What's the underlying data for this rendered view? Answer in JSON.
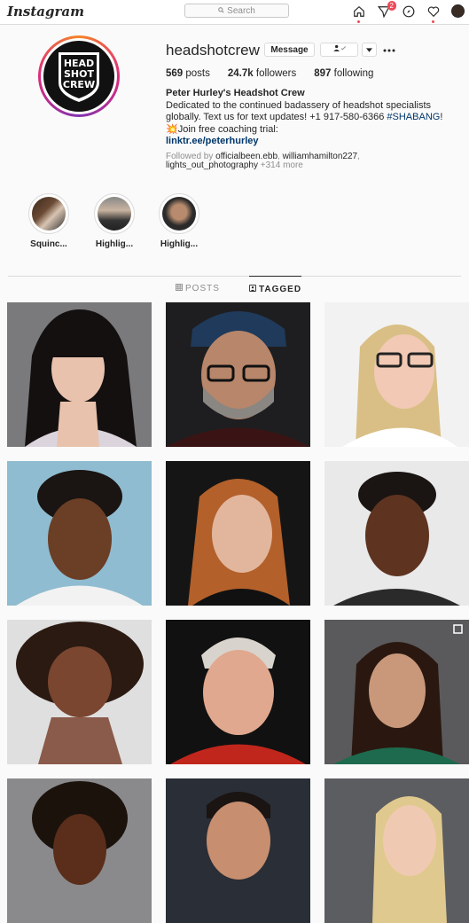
{
  "topbar": {
    "logo": "Instagram",
    "search_placeholder": "Search",
    "activity_badge": "2",
    "icons": [
      "home-icon",
      "direct-icon",
      "explore-icon",
      "heart-icon",
      "profile-icon"
    ]
  },
  "profile": {
    "username": "headshotcrew",
    "message_label": "Message",
    "posts_count": "569",
    "posts_label": "posts",
    "followers_count": "24.7k",
    "followers_label": "followers",
    "following_count": "897",
    "following_label": "following",
    "avatar_text_lines": [
      "HEAD",
      "SHOT",
      "CREW"
    ],
    "display_name": "Peter Hurley's Headshot Crew",
    "bio_line1": "Dedicated to the continued badassery of headshot specialists globally. Text us for text updates! +1 917-580-6366 ",
    "bio_hashtag": "#SHABANG",
    "bio_hashtag_end": "!",
    "bio_line2_emoji": "💥",
    "bio_line2": "Join free coaching trial:",
    "link": "linktr.ee/peterhurley",
    "followed_by_label": "Followed by ",
    "followed_user1": "officialbeen.ebb",
    "followed_sep": ", ",
    "followed_user2": "williamhamilton227",
    "followed_sep2": ", ",
    "followed_user3": "lights_out_photography",
    "followed_more": " +314 more"
  },
  "highlights": [
    {
      "label": "Squinc..."
    },
    {
      "label": "Highlig..."
    },
    {
      "label": "Highlig..."
    }
  ],
  "tabs": {
    "posts": "POSTS",
    "tagged": "TAGGED",
    "active": "tagged"
  },
  "colors": {
    "accent_link": "#00376b",
    "badge": "#ed4956"
  }
}
